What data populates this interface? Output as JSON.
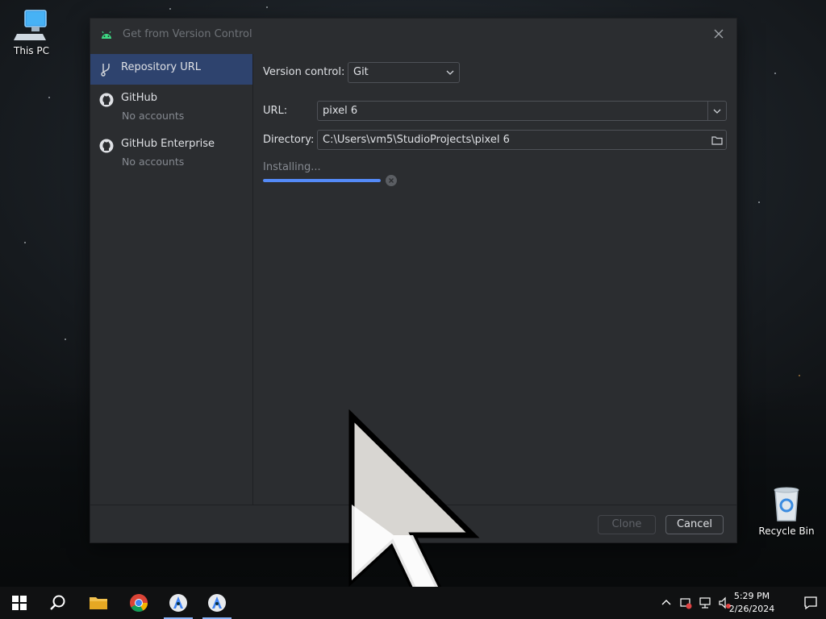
{
  "desktop": {
    "icons": [
      {
        "label": "This PC",
        "icon": "computer-icon"
      },
      {
        "label": "Recycle Bin",
        "icon": "recycle-bin-icon"
      }
    ]
  },
  "dialog": {
    "title": "Get from Version Control",
    "close_icon": "close-icon",
    "sidebar": {
      "items": [
        {
          "label": "Repository URL",
          "sublabel": "",
          "icon": "git-branch-icon",
          "selected": true
        },
        {
          "label": "GitHub",
          "sublabel": "No accounts",
          "icon": "github-icon",
          "selected": false
        },
        {
          "label": "GitHub Enterprise",
          "sublabel": "No accounts",
          "icon": "github-icon",
          "selected": false
        }
      ]
    },
    "form": {
      "version_control_label": "Version control:",
      "version_control_value": "Git",
      "url_label": "URL:",
      "url_value": "pixel 6",
      "directory_label": "Directory:",
      "directory_value": "C:\\Users\\vm5\\StudioProjects\\pixel 6"
    },
    "status": {
      "text": "Installing...",
      "progress_percent": 100
    },
    "buttons": {
      "clone": "Clone",
      "cancel": "Cancel"
    }
  },
  "taskbar": {
    "apps": [
      {
        "name": "start",
        "icon": "windows-start-icon"
      },
      {
        "name": "search",
        "icon": "search-icon"
      },
      {
        "name": "file-explorer",
        "icon": "folder-icon"
      },
      {
        "name": "chrome",
        "icon": "chrome-icon"
      },
      {
        "name": "android-studio-1",
        "icon": "android-studio-icon"
      },
      {
        "name": "android-studio-2",
        "icon": "android-studio-icon"
      }
    ],
    "clock": {
      "time": "5:29 PM",
      "date": "2/26/2024"
    }
  },
  "colors": {
    "dialog_bg": "#2b2d30",
    "selected_bg": "#2e436e",
    "accent": "#548af7"
  }
}
